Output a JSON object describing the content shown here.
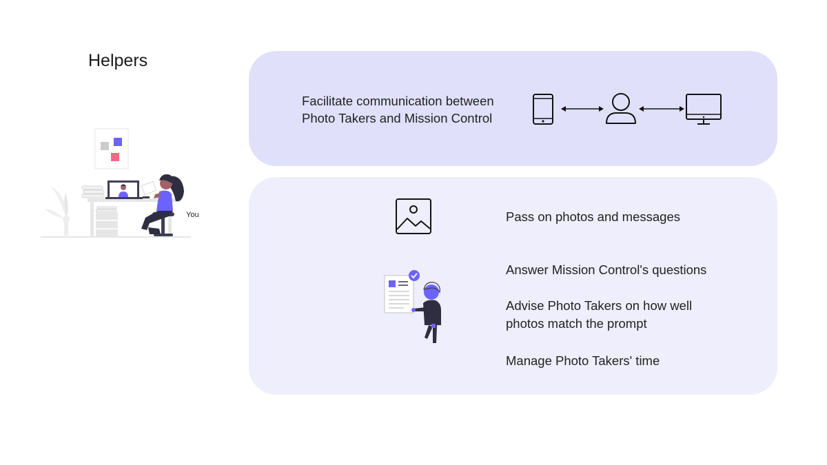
{
  "title": "Helpers",
  "illustration": {
    "you_label": "You"
  },
  "top_panel": {
    "text_line1": "Facilitate communication between",
    "text_line2": "Photo Takers and Mission Control",
    "flow_icons": [
      "phone-icon",
      "double-arrow-icon",
      "person-icon",
      "double-arrow-icon",
      "monitor-icon"
    ]
  },
  "bottom_panel": {
    "tasks": [
      "Pass on photos and messages",
      "Answer Mission Control's questions",
      "Advise Photo Takers on how well",
      "photos match the prompt",
      "Manage Photo Takers' time"
    ],
    "icons": [
      "image-icon",
      "checklist-person-illustration"
    ]
  },
  "colors": {
    "accent": "#6c63ff",
    "pink": "#f06a85",
    "top_panel_bg": "#e0e0fb",
    "bottom_panel_bg": "#eeeefc"
  }
}
